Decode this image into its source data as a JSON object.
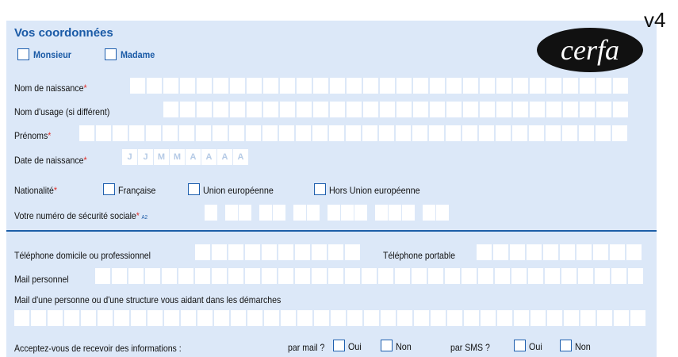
{
  "version": "v4",
  "logo_text": "cerfa",
  "section_title": "Vos coordonnées",
  "civility": {
    "monsieur": "Monsieur",
    "madame": "Madame"
  },
  "fields": {
    "nom_naissance": "Nom de naissance",
    "nom_usage": "Nom d'usage (si différent)",
    "prenoms": "Prénoms",
    "date_naissance": "Date de naissance",
    "nationalite": "Nationalité",
    "secu": "Votre numéro de sécurité sociale",
    "secu_ref": "A2",
    "tel_domicile": "Téléphone domicile ou professionnel",
    "tel_portable": "Téléphone portable",
    "mail_perso": "Mail personnel",
    "mail_aidant": "Mail d'une personne ou d'une structure vous aidant dans les démarches",
    "accept": "Acceptez-vous de recevoir des informations :"
  },
  "required_mark": "*",
  "date_placeholders": [
    "J",
    "J",
    "M",
    "M",
    "A",
    "A",
    "A",
    "A"
  ],
  "nationality_options": {
    "francaise": "Française",
    "ue": "Union européenne",
    "hors_ue": "Hors Union européenne"
  },
  "contact": {
    "par_mail": "par mail ?",
    "par_sms": "par SMS ?",
    "oui": "Oui",
    "non": "Non"
  },
  "colors": {
    "background": "#dce8f8",
    "accent": "#1a5aa6",
    "required": "#e0302a"
  }
}
